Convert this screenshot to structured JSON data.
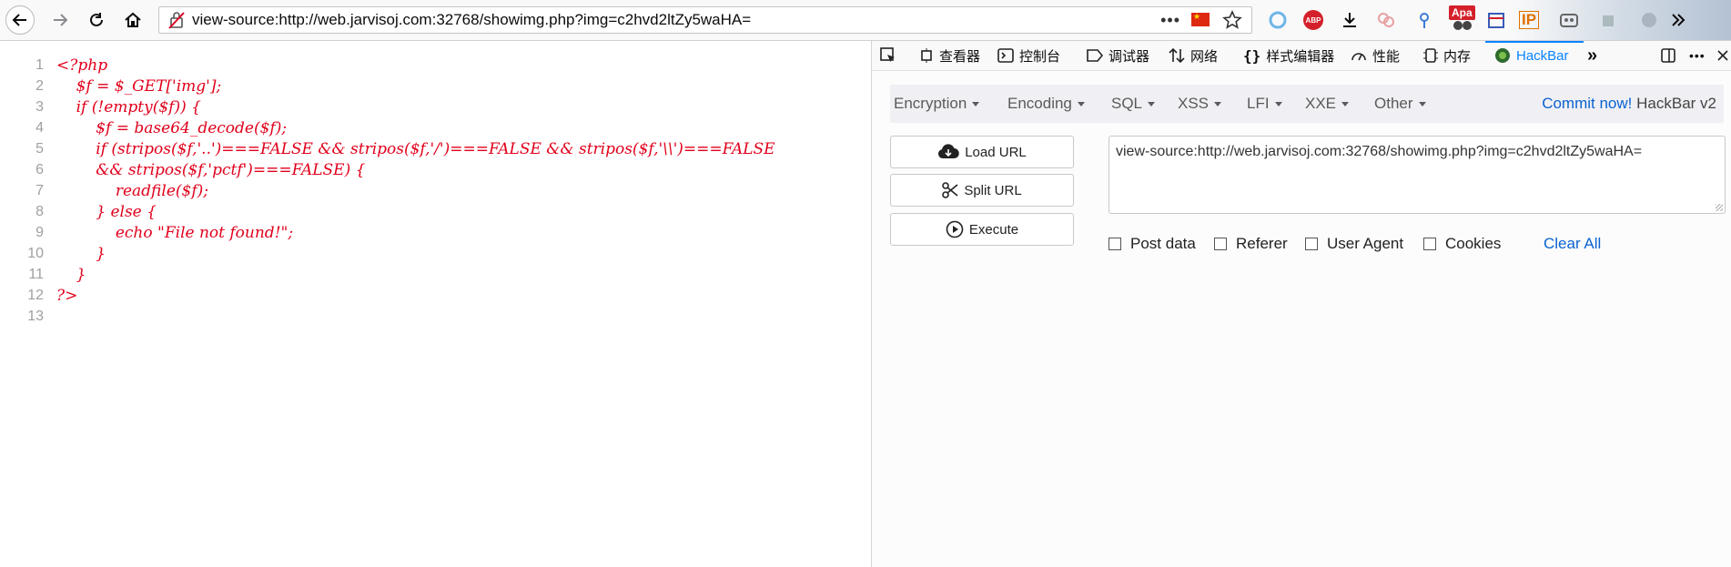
{
  "browser": {
    "url": "view-source:http://web.jarvisoj.com:32768/showimg.php?img=c2hvd2ltZy5waHA=",
    "page_actions_label": "•••",
    "flag_glyph": "★",
    "extensions": {
      "apa_label": "Apa",
      "abp_label": "ABP",
      "ip_label": "IP"
    }
  },
  "source": {
    "lines": [
      {
        "no": "1",
        "code": "<?php"
      },
      {
        "no": "2",
        "code": "    $f = $_GET['img'];"
      },
      {
        "no": "3",
        "code": "    if (!empty($f)) {"
      },
      {
        "no": "4",
        "code": "        $f = base64_decode($f);"
      },
      {
        "no": "5",
        "code": "        if (stripos($f,'..')===FALSE && stripos($f,'/')===FALSE && stripos($f,'\\\\')===FALSE"
      },
      {
        "no": "6",
        "code": "        && stripos($f,'pctf')===FALSE) {"
      },
      {
        "no": "7",
        "code": "            readfile($f);"
      },
      {
        "no": "8",
        "code": "        } else {"
      },
      {
        "no": "9",
        "code": "            echo \"File not found!\";"
      },
      {
        "no": "10",
        "code": "        }"
      },
      {
        "no": "11",
        "code": "    }"
      },
      {
        "no": "12",
        "code": "?>"
      },
      {
        "no": "13",
        "code": ""
      }
    ]
  },
  "devtools": {
    "tabs": [
      {
        "id": "inspector",
        "label": "查看器"
      },
      {
        "id": "console",
        "label": "控制台"
      },
      {
        "id": "debugger",
        "label": "调试器"
      },
      {
        "id": "network",
        "label": "网络"
      },
      {
        "id": "style-editor",
        "label": "样式编辑器"
      },
      {
        "id": "performance",
        "label": "性能"
      },
      {
        "id": "memory",
        "label": "内存"
      },
      {
        "id": "hackbar",
        "label": "HackBar"
      }
    ],
    "active_tab": "HackBar",
    "more_tabs_glyph": "»",
    "menu_glyph": "•••"
  },
  "hackbar": {
    "menus": [
      "Encryption",
      "Encoding",
      "SQL",
      "XSS",
      "LFI",
      "XXE",
      "Other"
    ],
    "commit_link": "Commit now!",
    "version": "HackBar v2",
    "buttons": {
      "load": "Load URL",
      "split": "Split URL",
      "execute": "Execute"
    },
    "url_value": "view-source:http://web.jarvisoj.com:32768/showimg.php?img=c2hvd2ltZy5waHA=",
    "checkboxes": [
      "Post data",
      "Referer",
      "User Agent",
      "Cookies"
    ],
    "clear_all": "Clear All"
  },
  "colors": {
    "code_text": "#e0001b",
    "line_numbers": "#a0a0a0",
    "accent": "#0a84ff",
    "link": "#0a62d0"
  }
}
